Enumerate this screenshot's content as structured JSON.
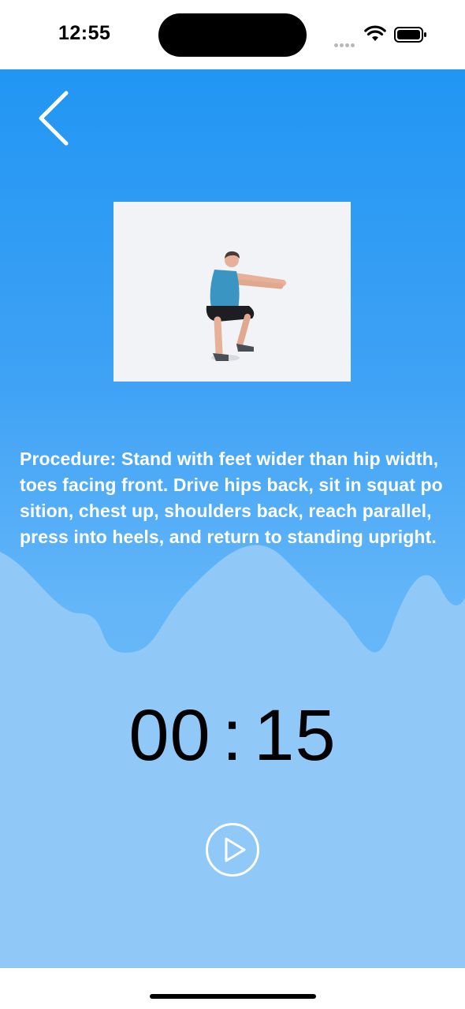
{
  "status_bar": {
    "time": "12:55"
  },
  "nav": {
    "back_icon": "chevron-left-icon"
  },
  "exercise": {
    "image_icon": "squat-illustration",
    "procedure_text": "Procedure: Stand with feet wider than hip width, toes facing front. Drive hips back, sit in squat position, chest up, shoulders back, reach parallel, press into heels, and return to standing upright."
  },
  "timer": {
    "minutes": "00",
    "separator": ":",
    "seconds": "15"
  },
  "controls": {
    "play_icon": "play-icon"
  },
  "colors": {
    "primary_blue": "#2196f3",
    "light_blue": "#90c8f8",
    "text_white": "#ffffff"
  }
}
